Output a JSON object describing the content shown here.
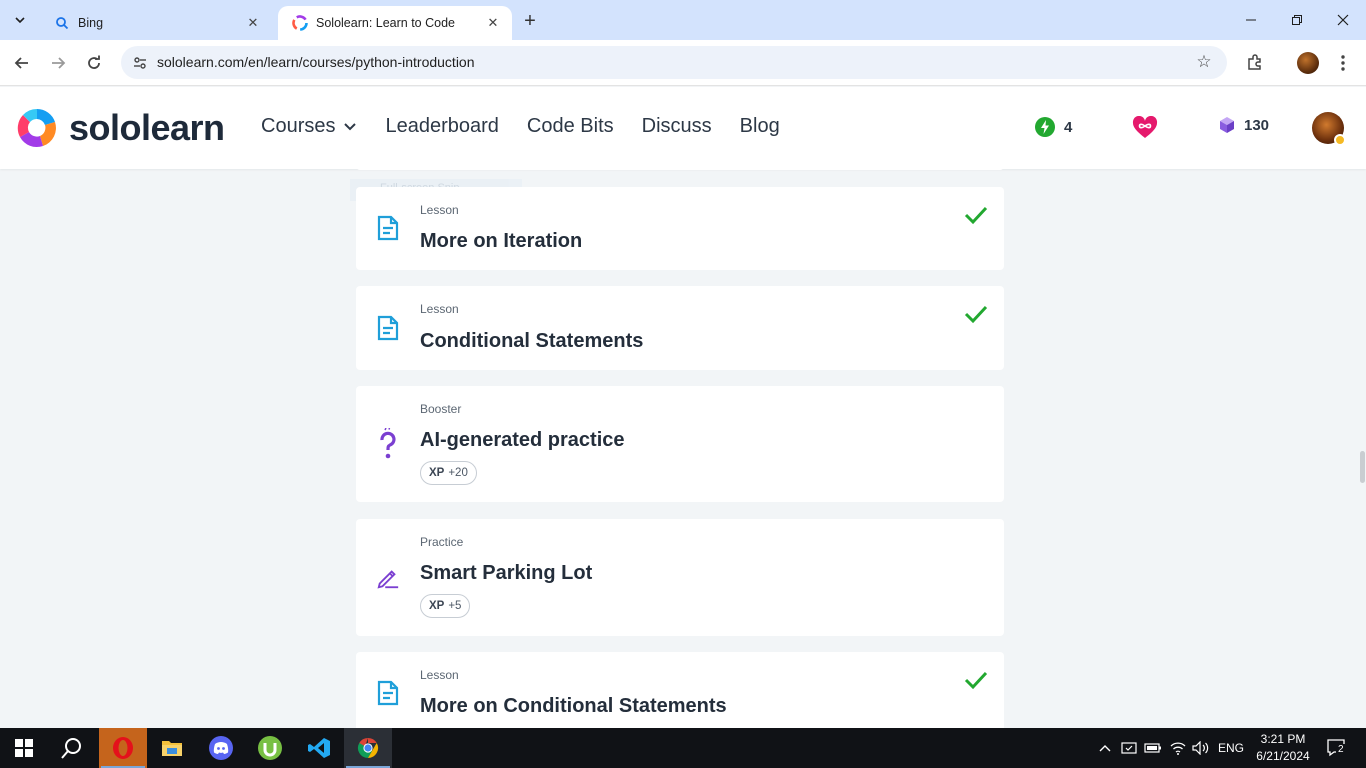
{
  "browser": {
    "tabs": [
      {
        "title": "Bing",
        "active": false
      },
      {
        "title": "Sololearn: Learn to Code",
        "active": true
      }
    ],
    "url": "sololearn.com/en/learn/courses/python-introduction"
  },
  "site": {
    "brand": "sololearn",
    "nav": [
      {
        "label": "Courses",
        "has_dropdown": true
      },
      {
        "label": "Leaderboard"
      },
      {
        "label": "Code Bits"
      },
      {
        "label": "Discuss"
      },
      {
        "label": "Blog"
      }
    ],
    "stats": {
      "streak": "4",
      "hearts_icon": "infinity-heart-icon",
      "bits": "130"
    }
  },
  "overlay_hint": "Full-screen Snip",
  "cards": [
    {
      "kind": "Lesson",
      "title": "More on Iteration",
      "icon": "lesson-icon",
      "completed": true
    },
    {
      "kind": "Lesson",
      "title": "Conditional Statements",
      "icon": "lesson-icon",
      "completed": true
    },
    {
      "kind": "Booster",
      "title": "AI-generated practice",
      "icon": "question-mark-icon",
      "completed": false,
      "xp_label": "XP",
      "xp_value": "+20"
    },
    {
      "kind": "Practice",
      "title": "Smart Parking Lot",
      "icon": "pencil-icon",
      "completed": false,
      "xp_label": "XP",
      "xp_value": "+5"
    },
    {
      "kind": "Lesson",
      "title": "More on Conditional Statements",
      "icon": "lesson-icon",
      "completed": true
    }
  ],
  "taskbar": {
    "language": "ENG",
    "time": "3:21 PM",
    "date": "6/21/2024",
    "notification_count": "2"
  },
  "colors": {
    "accent_green": "#22a830",
    "lesson_blue": "#1f9fd9",
    "purple": "#7b3fd1",
    "page_bg": "#f2f5f7"
  }
}
